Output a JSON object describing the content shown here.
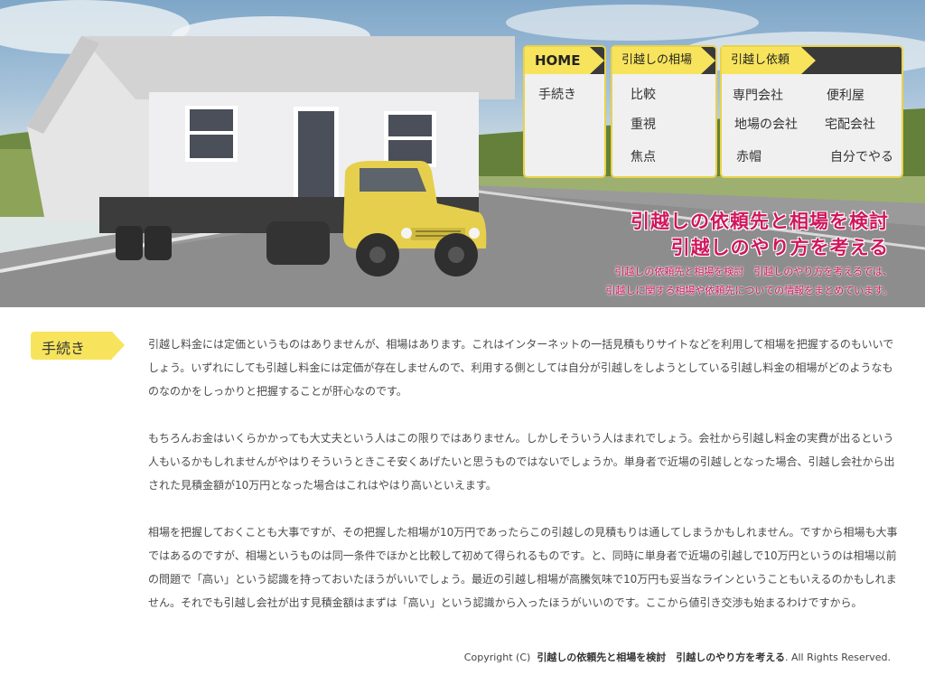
{
  "nav": {
    "home": "HOME",
    "home_items": [
      "手続き"
    ],
    "souba_tab": "引越しの相場",
    "souba_items": [
      "比較",
      "重視",
      "焦点"
    ],
    "irai_tab": "引越し依頼",
    "irai_items": [
      "専門会社",
      "便利屋",
      "地場の会社",
      "宅配会社",
      "赤帽",
      "自分でやる"
    ]
  },
  "header": {
    "tagline_line1": "引越しの依頼先と相場を検討",
    "tagline_line2": "引越しのやり方を考える",
    "desc_line1": "引越しの依頼先と相場を検討　引越しのやり方を考えるでは、",
    "desc_line2": "引越しに関する相場や依頼先についての情報をまとめています。"
  },
  "section": {
    "label": "手続き",
    "paragraphs": [
      "引越し料金には定価というものはありませんが、相場はあります。これはインターネットの一括見積もりサイトなどを利用して相場を把握するのもいいでしょう。いずれにしても引越し料金には定価が存在しませんので、利用する側としては自分が引越しをしようとしている引越し料金の相場がどのようなものなのかをしっかりと把握することが肝心なのです。",
      "もちろんお金はいくらかかっても大丈夫という人はこの限りではありません。しかしそういう人はまれでしょう。会社から引越し料金の実費が出るという人もいるかもしれませんがやはりそういうときこそ安くあげたいと思うものではないでしょうか。単身者で近場の引越しとなった場合、引越し会社から出された見積金額が10万円となった場合はこれはやはり高いといえます。",
      "相場を把握しておくことも大事ですが、その把握した相場が10万円であったらこの引越しの見積もりは通してしまうかもしれません。ですから相場も大事ではあるのですが、相場というものは同一条件でほかと比較して初めて得られるものです。と、同時に単身者で近場の引越しで10万円というのは相場以前の問題で「高い」という認識を持っておいたほうがいいでしょう。最近の引越し相場が高騰気味で10万円も妥当なラインということもいえるのかもしれません。それでも引越し会社が出す見積金額はまずは「高い」という認識から入ったほうがいいのです。ここから値引き交渉も始まるわけですから。"
    ]
  },
  "footer": {
    "prefix": "Copyright (C)",
    "site": "引越しの依頼先と相場を検討　引越しのやり方を考える",
    "suffix": ". All Rights Reserved."
  },
  "colors": {
    "accent_yellow": "#f7e45c",
    "tagline_pink": "#d0175c",
    "menu_dark": "#3a3a3a"
  }
}
